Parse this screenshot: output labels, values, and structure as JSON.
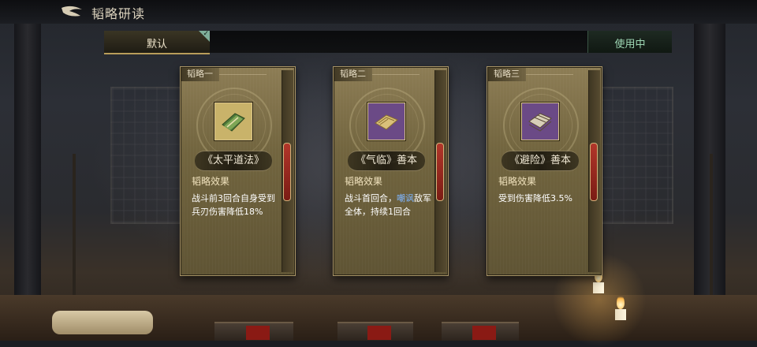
{
  "header": {
    "title": "韬略研读"
  },
  "tabs": {
    "default_label": "默认",
    "status_label": "使用中"
  },
  "cards": [
    {
      "tag": "韬略一",
      "name": "《太平道法》",
      "effect_title": "韬略效果",
      "desc_before": "战斗前3回合自身受到兵刃伤害降低18%",
      "desc_highlight": "",
      "desc_after": "",
      "icon": "green-scroll-book-icon",
      "icon_bg": "#c9b36a"
    },
    {
      "tag": "韬略二",
      "name": "《气临》善本",
      "effect_title": "韬略效果",
      "desc_before": "战斗首回合，",
      "desc_highlight": "嘲讽",
      "desc_after": "敌军全体，持续1回合",
      "icon": "open-scroll-book-icon",
      "icon_bg": "#6b4a86"
    },
    {
      "tag": "韬略三",
      "name": "《避险》善本",
      "effect_title": "韬略效果",
      "desc_before": "受到伤害降低3.5%",
      "desc_highlight": "",
      "desc_after": "",
      "icon": "stacked-book-icon",
      "icon_bg": "#6b4a86"
    }
  ],
  "colors": {
    "accent": "#b89d5a",
    "status": "#9fd8b5",
    "highlight": "#7fb6ff"
  }
}
